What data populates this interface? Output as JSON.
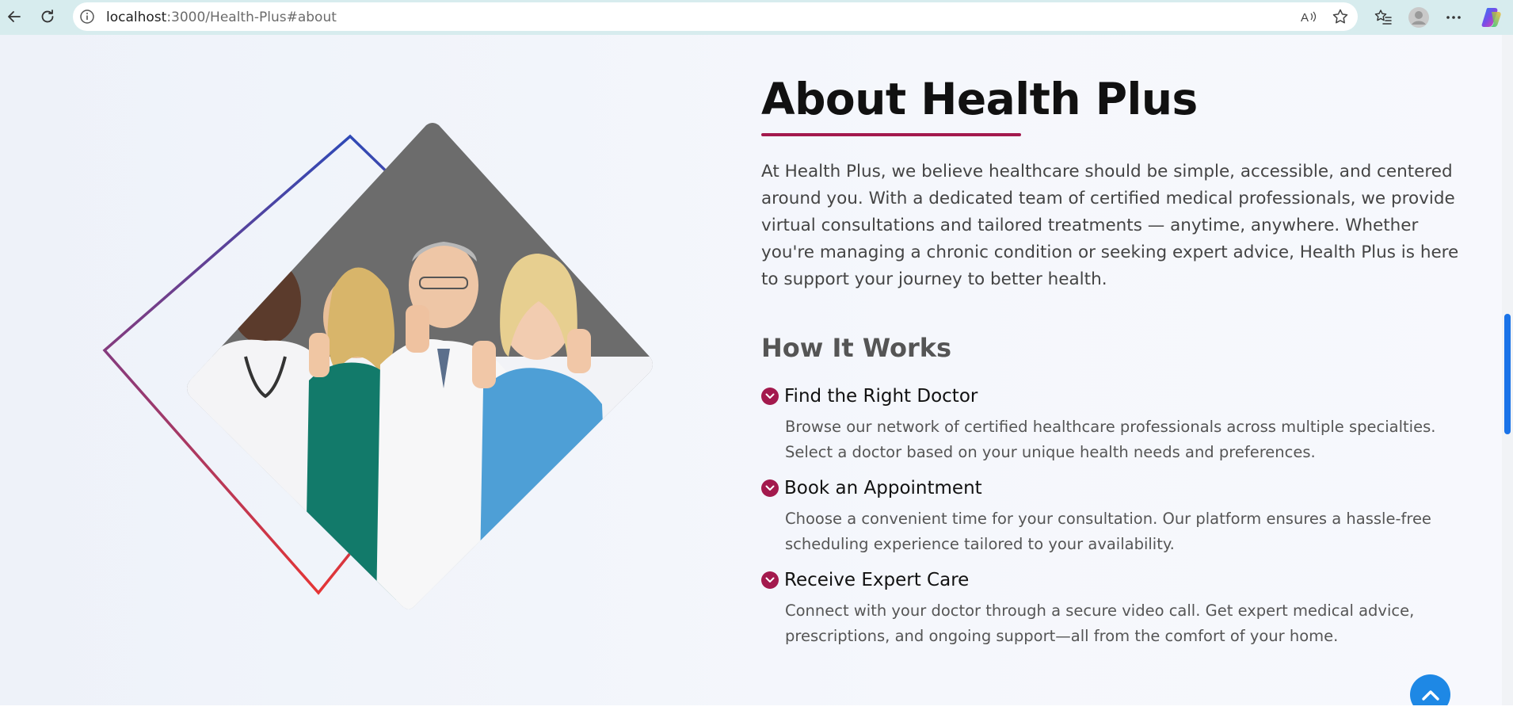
{
  "browser": {
    "url_host": "localhost",
    "url_path": ":3000/Health-Plus#about",
    "icons": {
      "back": "back-arrow-icon",
      "reload": "reload-icon",
      "info": "info-icon",
      "read_aloud": "read-aloud-icon",
      "favorite": "star-icon",
      "favorites": "favorites-icon",
      "profile": "profile-icon",
      "more": "more-icon",
      "copilot": "copilot-icon"
    }
  },
  "about": {
    "title": "About Health Plus",
    "intro": "At Health Plus, we believe healthcare should be simple, accessible, and centered around you. With a dedicated team of certified medical professionals, we provide virtual consultations and tailored treatments — anytime, anywhere. Whether you're managing a chronic condition or seeking expert advice, Health Plus is here to support your journey to better health.",
    "how_title": "How It Works",
    "steps": [
      {
        "title": "Find the Right Doctor",
        "desc": "Browse our network of certified healthcare professionals across multiple specialties. Select a doctor based on your unique health needs and preferences."
      },
      {
        "title": "Book an Appointment",
        "desc": "Choose a convenient time for your consultation. Our platform ensures a hassle-free scheduling experience tailored to your availability."
      },
      {
        "title": "Receive Expert Care",
        "desc": "Connect with your doctor through a secure video call. Get expert medical advice, prescriptions, and ongoing support—all from the comfort of your home."
      }
    ]
  },
  "colors": {
    "accent": "#a3194d",
    "scroll_button": "#1e88e5",
    "frame_gradient_top": "#2f49b6",
    "frame_gradient_bottom": "#e53535"
  }
}
